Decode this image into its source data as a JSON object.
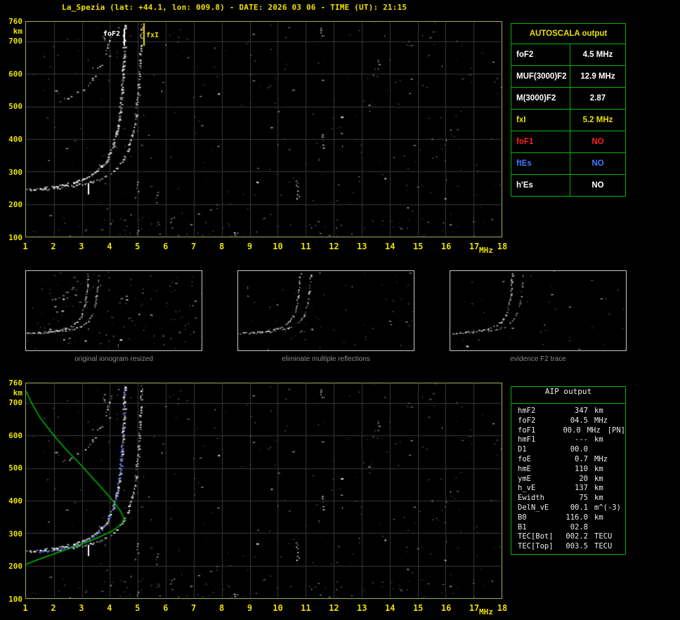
{
  "header": {
    "title": "La_Spezia (lat: +44.1, lon: 009.8) - DATE: 2026 03 06 - TIME (UT): 21:15"
  },
  "axes": {
    "y_ticks": [
      "760",
      "700",
      "600",
      "500",
      "400",
      "300",
      "200",
      "100"
    ],
    "y_unit": "km",
    "x_ticks": [
      "1",
      "2",
      "3",
      "4",
      "5",
      "6",
      "7",
      "8",
      "9",
      "10",
      "11",
      "12",
      "13",
      "14",
      "15",
      "16",
      "17",
      "18"
    ],
    "x_unit": "MHz"
  },
  "plot_labels": {
    "foF2": "foF2",
    "fxI": "fxI"
  },
  "autoscala": {
    "header": "AUTOSCALA output",
    "rows": [
      {
        "label": "foF2",
        "value": "4.5 MHz",
        "color": "#ffffff"
      },
      {
        "label": "MUF(3000)F2",
        "value": "12.9 MHz",
        "color": "#ffffff"
      },
      {
        "label": "M(3000)F2",
        "value": "2.87",
        "color": "#ffffff"
      },
      {
        "label": "fxI",
        "value": "5.2 MHz",
        "color": "#e8e000"
      },
      {
        "label": "foF1",
        "value": "NO",
        "color": "#ff2020"
      },
      {
        "label": "ftEs",
        "value": "NO",
        "color": "#4477ff"
      },
      {
        "label": "h'Es",
        "value": "NO",
        "color": "#ffffff"
      }
    ]
  },
  "aip": {
    "title": "AIP output",
    "rows": [
      {
        "label": "hmF2",
        "value": "347",
        "unit": "km",
        "extra": ""
      },
      {
        "label": "foF2",
        "value": "04.5",
        "unit": "MHz",
        "extra": ""
      },
      {
        "label": "foF1",
        "value": "00.0",
        "unit": "MHz",
        "extra": "[PN]"
      },
      {
        "label": "hmF1",
        "value": "---",
        "unit": "km",
        "extra": ""
      },
      {
        "label": "D1",
        "value": "00.0",
        "unit": "",
        "extra": ""
      },
      {
        "label": "foE",
        "value": "0.7",
        "unit": "MHz",
        "extra": ""
      },
      {
        "label": "hmE",
        "value": "110",
        "unit": "km",
        "extra": ""
      },
      {
        "label": "ymE",
        "value": "20",
        "unit": "km",
        "extra": ""
      },
      {
        "label": "h_vE",
        "value": "137",
        "unit": "km",
        "extra": ""
      },
      {
        "label": "Ewidth",
        "value": "75",
        "unit": "km",
        "extra": ""
      },
      {
        "label": "DelN_vE",
        "value": "00.1",
        "unit": "m^(-3)",
        "extra": ""
      },
      {
        "label": "B0",
        "value": "116.0",
        "unit": "km",
        "extra": ""
      },
      {
        "label": "B1",
        "value": "02.8",
        "unit": "",
        "extra": ""
      },
      {
        "label": "TEC[Bot]",
        "value": "002.2",
        "unit": "TECU",
        "extra": ""
      },
      {
        "label": "TEC[Top]",
        "value": "003.5",
        "unit": "TECU",
        "extra": ""
      }
    ]
  },
  "thumbnails": {
    "captions": [
      "original ionogram resized",
      "eliminate multiple reflections",
      "evidence F2 trace"
    ]
  },
  "chart_data": [
    {
      "type": "scatter",
      "title": "ionogram La_Spezia 2026-03-06 21:15 UT",
      "xlabel": "MHz",
      "ylabel": "km",
      "xlim": [
        1,
        18
      ],
      "ylim": [
        100,
        760
      ],
      "grid": true,
      "series": [
        {
          "name": "F2 ordinary trace",
          "points": [
            [
              1.0,
              245
            ],
            [
              1.15,
              246
            ],
            [
              1.3,
              247
            ],
            [
              1.45,
              249
            ],
            [
              1.6,
              250
            ],
            [
              1.75,
              252
            ],
            [
              1.9,
              254
            ],
            [
              2.05,
              256
            ],
            [
              2.2,
              258
            ],
            [
              2.35,
              261
            ],
            [
              2.5,
              264
            ],
            [
              2.65,
              267
            ],
            [
              2.8,
              271
            ],
            [
              2.95,
              275
            ],
            [
              3.1,
              281
            ],
            [
              3.25,
              287
            ],
            [
              3.4,
              295
            ],
            [
              3.5,
              301
            ],
            [
              3.6,
              309
            ],
            [
              3.7,
              318
            ],
            [
              3.8,
              329
            ],
            [
              3.9,
              343
            ],
            [
              4.0,
              361
            ],
            [
              4.08,
              379
            ],
            [
              4.16,
              403
            ],
            [
              4.24,
              435
            ],
            [
              4.32,
              481
            ],
            [
              4.38,
              531
            ],
            [
              4.43,
              588
            ],
            [
              4.47,
              653
            ],
            [
              4.5,
              718
            ],
            [
              4.52,
              756
            ]
          ]
        },
        {
          "name": "F2 extraordinary trace",
          "points": [
            [
              1.6,
              246
            ],
            [
              1.9,
              248
            ],
            [
              2.2,
              251
            ],
            [
              2.5,
              255
            ],
            [
              2.8,
              259
            ],
            [
              3.1,
              264
            ],
            [
              3.4,
              271
            ],
            [
              3.7,
              281
            ],
            [
              3.9,
              289
            ],
            [
              4.1,
              301
            ],
            [
              4.3,
              318
            ],
            [
              4.5,
              343
            ],
            [
              4.65,
              372
            ],
            [
              4.8,
              418
            ],
            [
              4.9,
              468
            ],
            [
              5.0,
              551
            ],
            [
              5.06,
              635
            ],
            [
              5.1,
              718
            ],
            [
              5.12,
              752
            ]
          ]
        },
        {
          "name": "second-hop reflection",
          "points": [
            [
              2.2,
              516
            ],
            [
              2.4,
              523
            ],
            [
              2.6,
              532
            ],
            [
              2.8,
              541
            ],
            [
              3.0,
              554
            ],
            [
              3.2,
              569
            ],
            [
              3.4,
              590
            ],
            [
              3.55,
              610
            ],
            [
              3.7,
              636
            ],
            [
              3.85,
              672
            ],
            [
              3.95,
              700
            ],
            [
              4.05,
              736
            ],
            [
              4.1,
              756
            ]
          ]
        }
      ],
      "markers": {
        "foF2_MHz": 4.5,
        "fxI_MHz": 5.2,
        "hF_tick": {
          "f": 3.2,
          "km1": 228,
          "km2": 263
        }
      }
    },
    {
      "type": "line",
      "title": "AIP electron density profile over ionogram",
      "xlabel": "MHz",
      "ylabel": "km",
      "xlim": [
        1,
        18
      ],
      "ylim": [
        100,
        760
      ],
      "series": [
        {
          "name": "plasma frequency profile",
          "color": "#00bb00",
          "points": [
            [
              1.0,
              736
            ],
            [
              1.2,
              700
            ],
            [
              1.5,
              655
            ],
            [
              1.9,
              610
            ],
            [
              2.4,
              560
            ],
            [
              2.9,
              515
            ],
            [
              3.4,
              468
            ],
            [
              3.8,
              430
            ],
            [
              4.1,
              400
            ],
            [
              4.35,
              372
            ],
            [
              4.5,
              347
            ],
            [
              4.45,
              333
            ],
            [
              4.3,
              320
            ],
            [
              4.05,
              305
            ],
            [
              3.6,
              287
            ],
            [
              3.1,
              270
            ],
            [
              2.6,
              254
            ],
            [
              2.1,
              239
            ],
            [
              1.6,
              224
            ],
            [
              1.2,
              211
            ],
            [
              1.0,
              204
            ]
          ]
        },
        {
          "name": "fitted F2 trace",
          "color": "#4466ee",
          "source_series": "F2 ordinary trace"
        }
      ]
    }
  ],
  "render_hints": {
    "noise_seed": 20260306,
    "thumb_f_max": 11,
    "colors": {
      "axis": "#e8e000",
      "grid": "#383838",
      "table_border": "#00b400",
      "profile_green": "#00bb00",
      "fitted_blue": "#4466ee",
      "caption_gray": "#8a8a8a"
    }
  }
}
